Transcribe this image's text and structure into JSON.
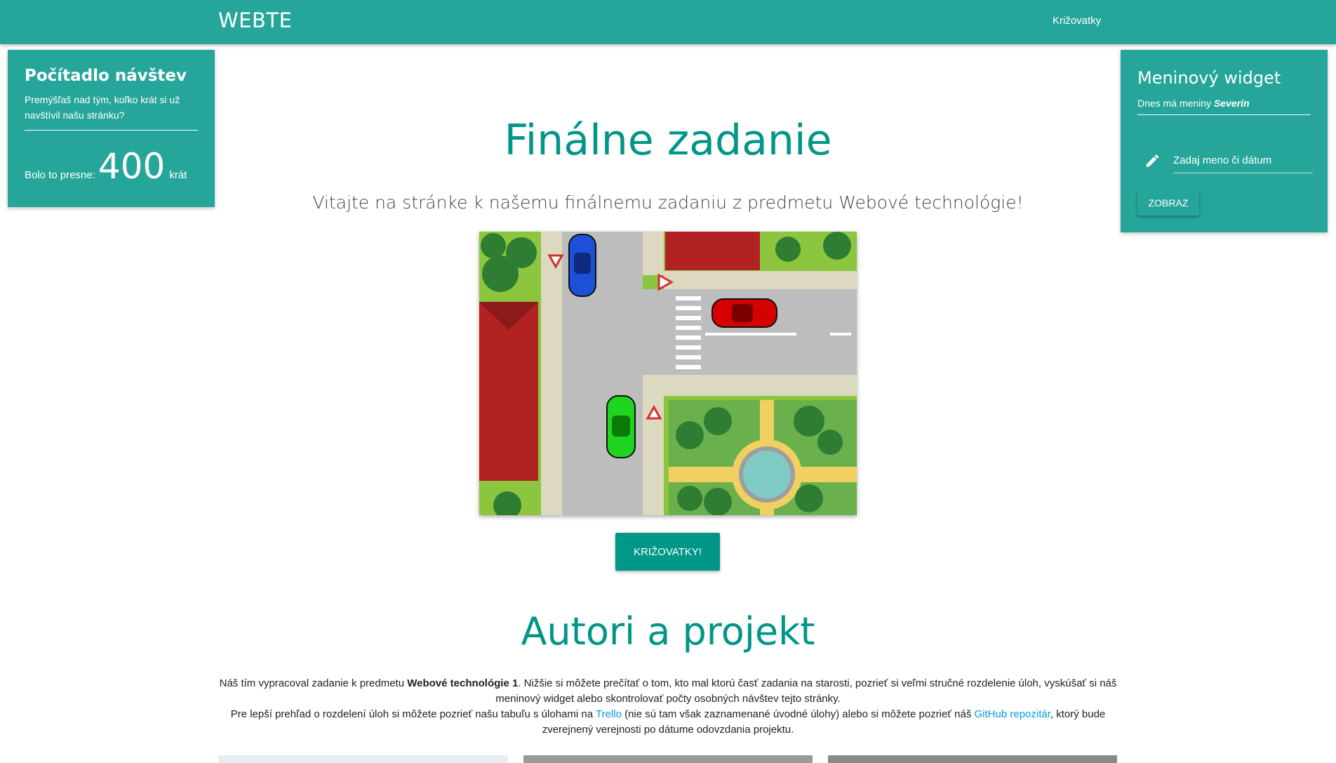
{
  "navbar": {
    "brand": "WEBTE",
    "link": "Križovatky"
  },
  "counter": {
    "title": "Počítadlo návštev",
    "description": "Premýšľaš nad tým, koľko krát si už navštívil našu stránku?",
    "prefix": "Bolo to presne:",
    "count": "400",
    "suffix": "krát"
  },
  "names_widget": {
    "title": "Meninový widget",
    "today_prefix": "Dnes má meniny",
    "today_name": "Severín",
    "input_placeholder": "Zadaj meno či dátum",
    "button": "ZOBRAZ"
  },
  "hero": {
    "title": "Finálne zadanie",
    "subtitle": "Vitajte na stránke k našemu finálnemu zadaniu z predmetu Webové technológie!",
    "button": "KRIŽOVATKY!"
  },
  "about": {
    "title": "Autori a projekt",
    "p1_before": "Náš tím vypracoval zadanie k predmetu ",
    "p1_bold": "Webové technológie 1",
    "p1_after": ". Nižšie si môžete prečítať o tom, kto mal ktorú časť zadania na starosti, pozrieť si veľmi stručné rozdelenie úloh, vyskúšať si náš meninový widget alebo skontrolovať počty osobných návštev tejto stránky.",
    "p2_before": "Pre lepší prehľad o rozdelení úloh si môžete pozrieť našu tabuľu s úlohami na ",
    "p2_link1": "Trello",
    "p2_middle": " (nie sú tam však zaznamenané úvodné úlohy) alebo si môžete pozrieť náš ",
    "p2_link2": "GitHub repozitár",
    "p2_after": ", ktorý bude zverejnený verejnosti po dátume odovzdania projektu."
  },
  "colors": {
    "primary": "#26a69a",
    "accent": "#009688",
    "link": "#039be5"
  }
}
